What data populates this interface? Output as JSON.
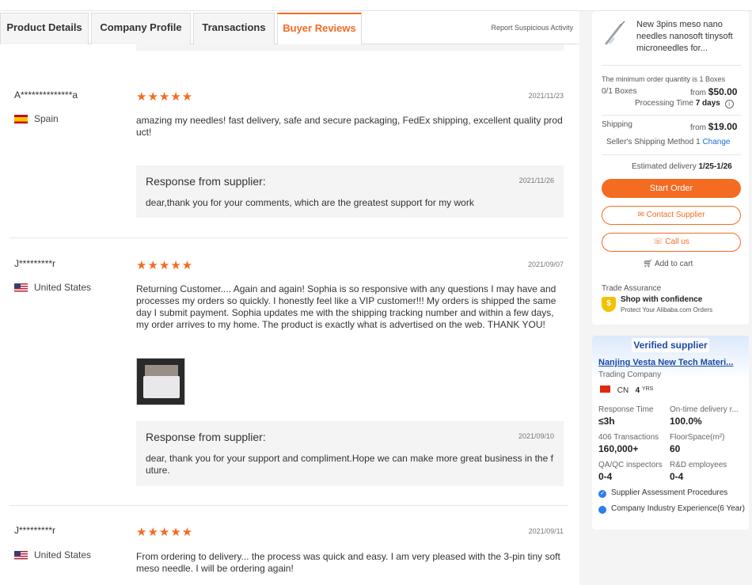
{
  "tabs": [
    "Product Details",
    "Company Profile",
    "Transactions",
    "Buyer Reviews"
  ],
  "report_link": "Report Suspicious Activity",
  "reviews": [
    {
      "reviewer": "A**************a",
      "country": "Spain",
      "rating": 5,
      "date": "2021/11/23",
      "comment": "amazing my needles! fast delivery, safe and secure packaging, FedEx shipping, excellent quality product!",
      "response_title": "Response from supplier:",
      "response_date": "2021/11/26",
      "response_text": "dear,thank you for your comments, which are the greatest support for my work"
    },
    {
      "reviewer": "J*********r",
      "country": "United States",
      "rating": 5,
      "date": "2021/09/07",
      "comment": "Returning Customer.... Again and again! Sophia is so responsive with any questions I may have and processes my orders so quickly. I honestly feel like a VIP customer!!! My orders is shipped the same day I submit payment. Sophia updates me with the shipping tracking number and within a few days, my order arrives to my home. The product is exactly what is advertised on the web. THANK YOU!",
      "response_title": "Response from supplier:",
      "response_date": "2021/09/10",
      "response_text": "dear, thank you for your support and compliment.Hope we can make more great business in the future."
    },
    {
      "reviewer": "J*********r",
      "country": "United States",
      "rating": 5,
      "date": "2021/09/11",
      "comment": "From ordering to delivery... the process was quick and easy. I am very pleased with the 3-pin tiny soft meso needle. I will be ordering again!"
    }
  ],
  "order_panel": {
    "product_title": "New 3pins meso nano needles nanosoft tinysoft microneedles for...",
    "moq_text": "The minimum order quantity is 1 Boxes",
    "boxes_label": "0/1 Boxes",
    "from_1": "from",
    "price": "$50.00",
    "processing_label": "Processing Time",
    "processing_value": "7 days",
    "shipping_label": "Shipping",
    "from_2": "from",
    "shipping_price": "$19.00",
    "shipping_method": "Seller's Shipping Method 1",
    "change_link": "Change",
    "delivery_label": "Estimated delivery",
    "delivery_value": "1/25-1/26",
    "start_order": "Start Order",
    "contact_supplier": "Contact Supplier",
    "call_us": "Call us",
    "add_to_cart": "Add to cart",
    "trade_assurance": "Trade Assurance",
    "shop_confidence": "Shop with confidence",
    "protect_text": "Protect Your Alibaba.com Orders"
  },
  "supplier": {
    "badge": "Verified supplier",
    "name": "Nanjing Vesta New Tech Materi...",
    "type": "Trading Company",
    "country": "CN",
    "years": "4",
    "years_unit": "YRS",
    "stats": [
      {
        "label": "Response Time",
        "value": "≤3h"
      },
      {
        "label": "On-time delivery r...",
        "value": "100.0%"
      },
      {
        "label": "406 Transactions",
        "value": "160,000+"
      },
      {
        "label": "FloorSpace(m²)",
        "value": "60"
      },
      {
        "label": "QA/QC inspectors",
        "value": "0-4"
      },
      {
        "label": "R&D employees",
        "value": "0-4"
      }
    ],
    "checks": [
      "Supplier Assessment Procedures",
      "Company Industry Experience(6 Year)"
    ]
  }
}
